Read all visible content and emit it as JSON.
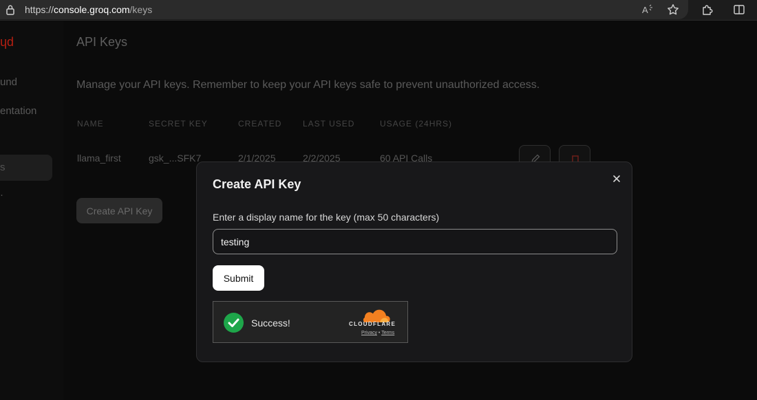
{
  "browser": {
    "url_scheme": "https://",
    "url_host": "console.groq.com",
    "url_path": "/keys"
  },
  "sidebar": {
    "brand": "ɥd",
    "items": [
      {
        "label": "und"
      },
      {
        "label": "entation"
      },
      {
        "label": "s"
      },
      {
        "label": "·"
      }
    ]
  },
  "page": {
    "title": "API Keys",
    "description": "Manage your API keys. Remember to keep your API keys safe to prevent unauthorized access.",
    "columns": [
      "NAME",
      "SECRET KEY",
      "CREATED",
      "LAST USED",
      "USAGE (24HRS)"
    ],
    "rows": [
      {
        "name": "llama_first",
        "secret_key": "gsk_...SFK7",
        "created": "2/1/2025",
        "last_used": "2/2/2025",
        "usage": "60 API Calls"
      }
    ],
    "create_button": "Create API Key"
  },
  "modal": {
    "title": "Create API Key",
    "field_label": "Enter a display name for the key (max 50 characters)",
    "input_value": "testing",
    "submit_label": "Submit",
    "captcha": {
      "status": "Success!",
      "provider": "CLOUDFLARE",
      "privacy": "Privacy",
      "separator": "•",
      "terms": "Terms"
    }
  },
  "colors": {
    "accent_orange": "#f38020",
    "success_green": "#1ea64a",
    "brand_red": "#b51f12",
    "delete_red": "#b3261e"
  },
  "icons": [
    "lock-icon",
    "read-aloud-icon",
    "favorite-star-icon",
    "extensions-icon",
    "split-screen-icon",
    "edit-icon",
    "delete-icon",
    "close-icon",
    "check-icon",
    "cloudflare-cloud-icon"
  ]
}
